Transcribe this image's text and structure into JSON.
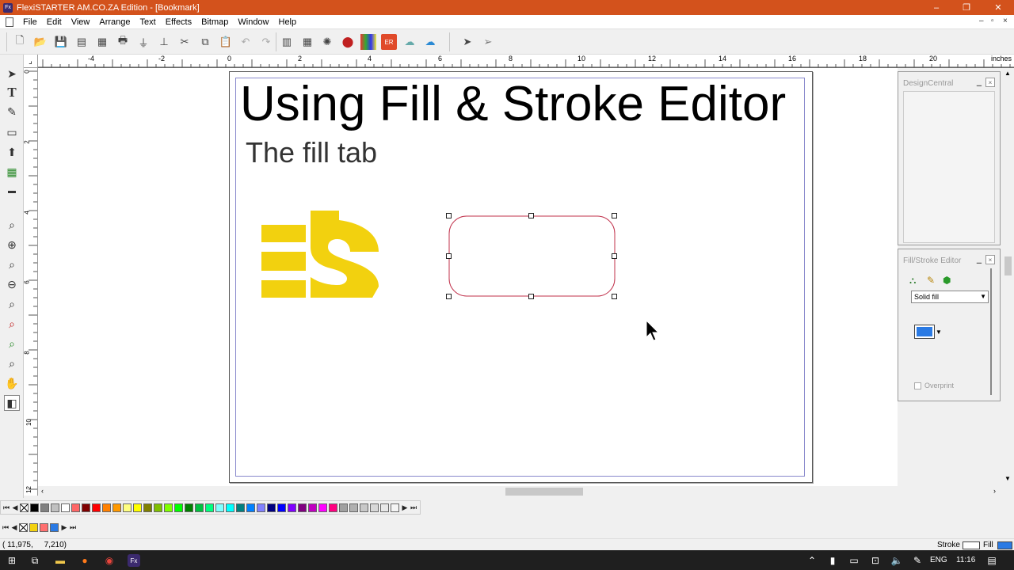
{
  "window": {
    "title": "FlexiSTARTER AM.CO.ZA Edition - [Bookmark]",
    "app_icon": "Fx",
    "minimize": "–",
    "maximize": "❐",
    "close": "✕"
  },
  "menu": {
    "items": [
      "File",
      "Edit",
      "View",
      "Arrange",
      "Text",
      "Effects",
      "Bitmap",
      "Window",
      "Help"
    ],
    "mdi_minimize": "–",
    "mdi_restore": "▫",
    "mdi_close": "×"
  },
  "ruler": {
    "h_labels": [
      "-4",
      "-2",
      "0",
      "2",
      "4",
      "6",
      "8",
      "10",
      "12",
      "14",
      "16",
      "18",
      "20"
    ],
    "h_unit": "inches",
    "v_labels": [
      "0",
      "2",
      "4",
      "6",
      "8",
      "10",
      "12"
    ]
  },
  "document": {
    "heading": "Using Fill & Stroke Editor",
    "subheading": "The fill tab",
    "logo_color": "#f2d10f",
    "shape_stroke": "#c0304a"
  },
  "panels": {
    "design_central": {
      "title": "DesignCentral",
      "min": "▁",
      "close": "×"
    },
    "fill_stroke": {
      "title": "Fill/Stroke Editor",
      "min": "▁",
      "close": "×",
      "fill_type": "Solid fill",
      "fill_color": "#2a7ae4",
      "overprint_label": "Overprint"
    }
  },
  "palette": {
    "row1": [
      "#000000",
      "#808080",
      "#c0c0c0",
      "#ffffff",
      "#ff6666",
      "#800000",
      "#ff0000",
      "#ff8000",
      "#ff9900",
      "#ffff80",
      "#ffff00",
      "#808000",
      "#80c000",
      "#80ff00",
      "#00ff00",
      "#008000",
      "#00c040",
      "#00ff80",
      "#80ffff",
      "#00ffff",
      "#008080",
      "#0080ff",
      "#8080ff",
      "#000080",
      "#0000ff",
      "#8000ff",
      "#800080",
      "#c000c0",
      "#ff00ff",
      "#ff0080",
      "#a0a0a0",
      "#b0b0b0",
      "#c8c8c8",
      "#d8d8d8",
      "#e8e8e8",
      "#f4f4f4"
    ],
    "row2": [
      "#f2d10f",
      "#ff7070",
      "#2a7ae4"
    ]
  },
  "status": {
    "coords": "( 11,975,     7,210)",
    "stroke_label": "Stroke",
    "fill_label": "Fill",
    "fill_color": "#2a7ae4"
  },
  "taskbar": {
    "lang": "ENG",
    "time": "11:16"
  }
}
